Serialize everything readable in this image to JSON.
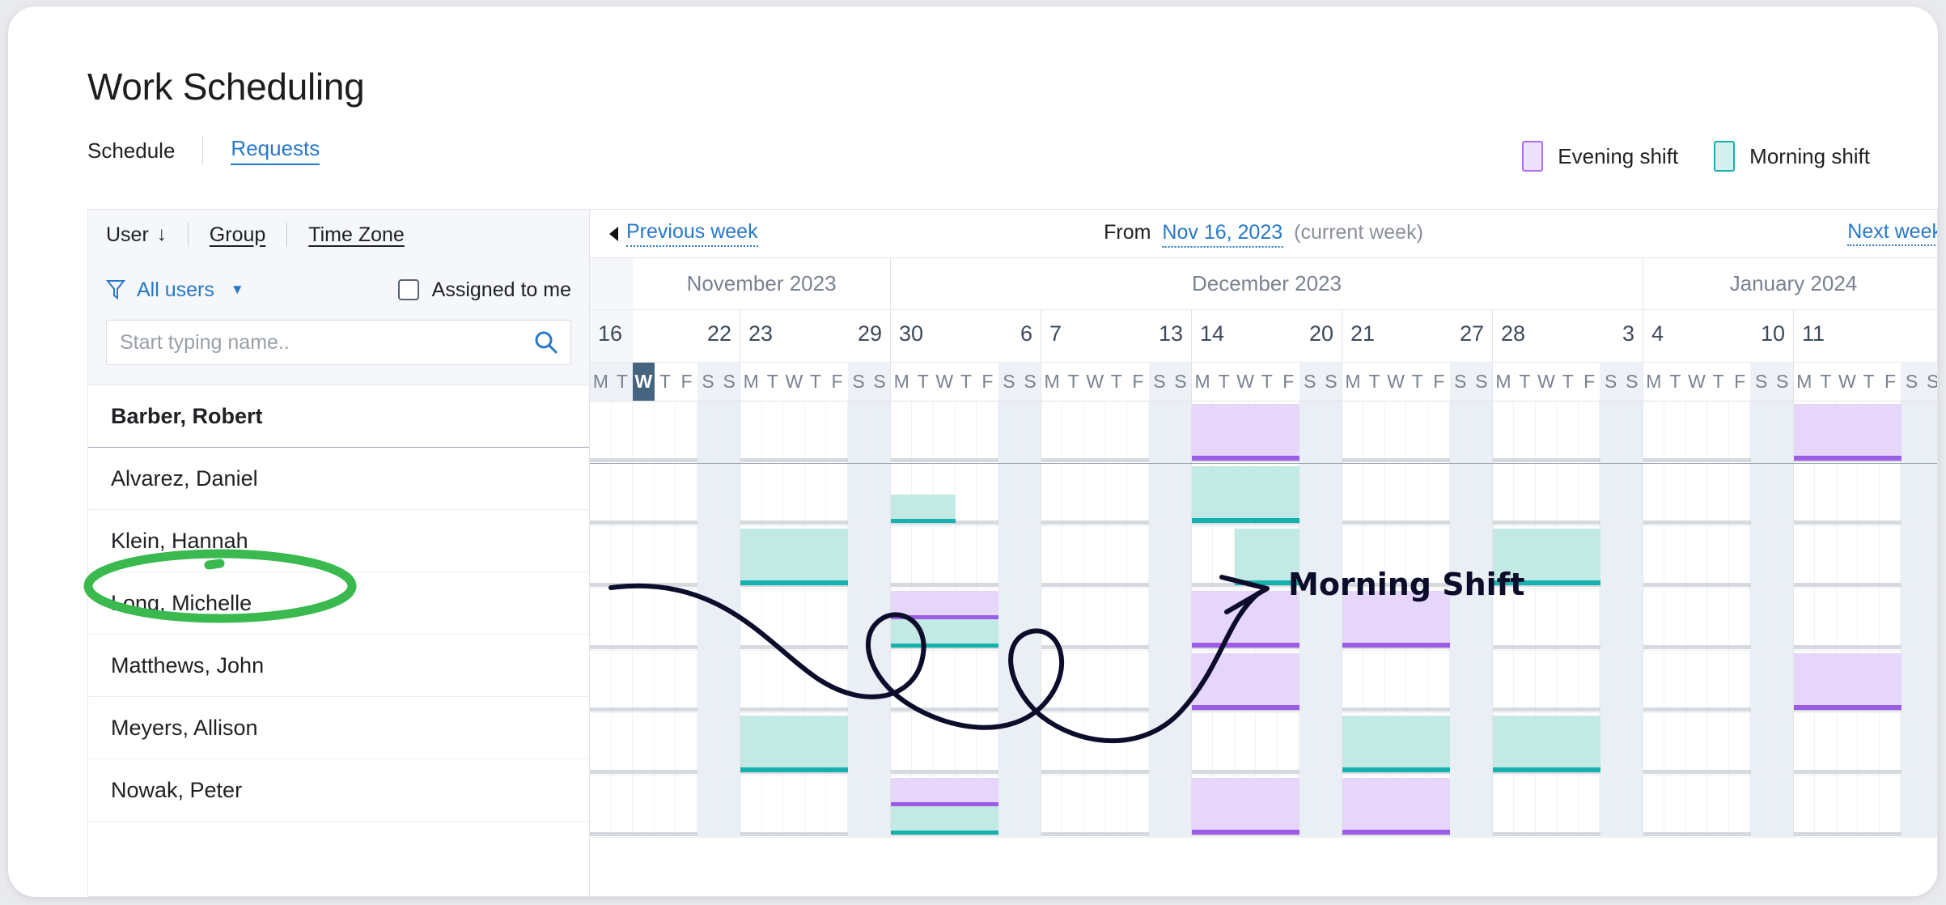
{
  "page": {
    "title": "Work Scheduling"
  },
  "tabs": {
    "schedule": "Schedule",
    "requests": "Requests"
  },
  "legend": {
    "evening": {
      "label": "Evening shift",
      "color": "#eee1fb",
      "border": "#ab6ff0"
    },
    "morning": {
      "label": "Morning shift",
      "color": "#d4f1ee",
      "border": "#16b1ad"
    }
  },
  "sidebar": {
    "sort": {
      "user": "User",
      "user_sort_icon": "arrow-down-icon",
      "group": "Group",
      "timezone": "Time Zone"
    },
    "filter": {
      "icon": "funnel-icon",
      "label": "All users",
      "chevron": "chevron-down-icon"
    },
    "assigned_to_me": {
      "label": "Assigned to me",
      "checked": false
    },
    "search": {
      "placeholder": "Start typing name..",
      "value": "",
      "icon": "search-icon"
    },
    "users": [
      {
        "name": "Barber, Robert"
      },
      {
        "name": "Alvarez, Daniel"
      },
      {
        "name": "Klein, Hannah"
      },
      {
        "name": "Long, Michelle"
      },
      {
        "name": "Matthews, John"
      },
      {
        "name": "Meyers, Allison"
      },
      {
        "name": "Nowak, Peter"
      }
    ]
  },
  "calendar": {
    "toolbar": {
      "previous": "Previous week",
      "previous_icon": "triangle-left-icon",
      "from_label": "From",
      "from_date": "Nov 16, 2023",
      "current_note": "(current week)",
      "next": "Next week"
    },
    "months": [
      {
        "label": "",
        "partial": true
      },
      {
        "label": "November 2023",
        "weeks": 2
      },
      {
        "label": "December 2023",
        "weeks": 5
      },
      {
        "label": "January 2024",
        "weeks": 2
      }
    ],
    "weeks": [
      {
        "start": "16",
        "end": "22",
        "partial": true
      },
      {
        "start": "23",
        "end": "29"
      },
      {
        "start": "30",
        "end": "6"
      },
      {
        "start": "7",
        "end": "13"
      },
      {
        "start": "14",
        "end": "20"
      },
      {
        "start": "21",
        "end": "27"
      },
      {
        "start": "28",
        "end": "3"
      },
      {
        "start": "4",
        "end": "10"
      },
      {
        "start": "11",
        "end": ""
      }
    ],
    "day_letters": [
      "M",
      "T",
      "W",
      "T",
      "F",
      "S",
      "S"
    ],
    "today": {
      "week_index": 0,
      "day_index": 2,
      "letter": "W"
    },
    "past_days": [
      0,
      1
    ],
    "shifts": [
      {
        "row": 0,
        "week": 4,
        "day_start": 0,
        "days": 5,
        "type": "evening"
      },
      {
        "row": 0,
        "week": 8,
        "day_start": 0,
        "days": 5,
        "type": "evening"
      },
      {
        "row": 1,
        "week": 2,
        "day_start": 0,
        "days": 3,
        "type": "morning",
        "size": "half"
      },
      {
        "row": 1,
        "week": 4,
        "day_start": 0,
        "days": 5,
        "type": "morning"
      },
      {
        "row": 2,
        "week": 1,
        "day_start": 0,
        "days": 5,
        "type": "morning"
      },
      {
        "row": 2,
        "week": 4,
        "day_start": 2,
        "days": 3,
        "type": "morning"
      },
      {
        "row": 2,
        "week": 6,
        "day_start": 0,
        "days": 5,
        "type": "morning"
      },
      {
        "row": 3,
        "week": 2,
        "day_start": 0,
        "days": 5,
        "type": "evening",
        "size": "tophalf"
      },
      {
        "row": 3,
        "week": 2,
        "day_start": 0,
        "days": 5,
        "type": "morning",
        "size": "half"
      },
      {
        "row": 3,
        "week": 4,
        "day_start": 0,
        "days": 5,
        "type": "evening"
      },
      {
        "row": 3,
        "week": 5,
        "day_start": 0,
        "days": 5,
        "type": "evening"
      },
      {
        "row": 4,
        "week": 4,
        "day_start": 0,
        "days": 5,
        "type": "evening"
      },
      {
        "row": 4,
        "week": 8,
        "day_start": 0,
        "days": 5,
        "type": "evening"
      },
      {
        "row": 5,
        "week": 1,
        "day_start": 0,
        "days": 5,
        "type": "morning"
      },
      {
        "row": 5,
        "week": 5,
        "day_start": 0,
        "days": 5,
        "type": "morning"
      },
      {
        "row": 5,
        "week": 6,
        "day_start": 0,
        "days": 5,
        "type": "morning"
      },
      {
        "row": 6,
        "week": 2,
        "day_start": 0,
        "days": 5,
        "type": "evening",
        "size": "tophalf"
      },
      {
        "row": 6,
        "week": 2,
        "day_start": 0,
        "days": 5,
        "type": "morning",
        "size": "half"
      },
      {
        "row": 6,
        "week": 4,
        "day_start": 0,
        "days": 5,
        "type": "evening"
      },
      {
        "row": 6,
        "week": 5,
        "day_start": 0,
        "days": 5,
        "type": "evening"
      }
    ]
  },
  "annotation": {
    "label": "Morning Shift",
    "highlight_target": "Klein, Hannah",
    "highlight_color": "#3aba4e",
    "arrow_color": "#0c0c2b"
  }
}
